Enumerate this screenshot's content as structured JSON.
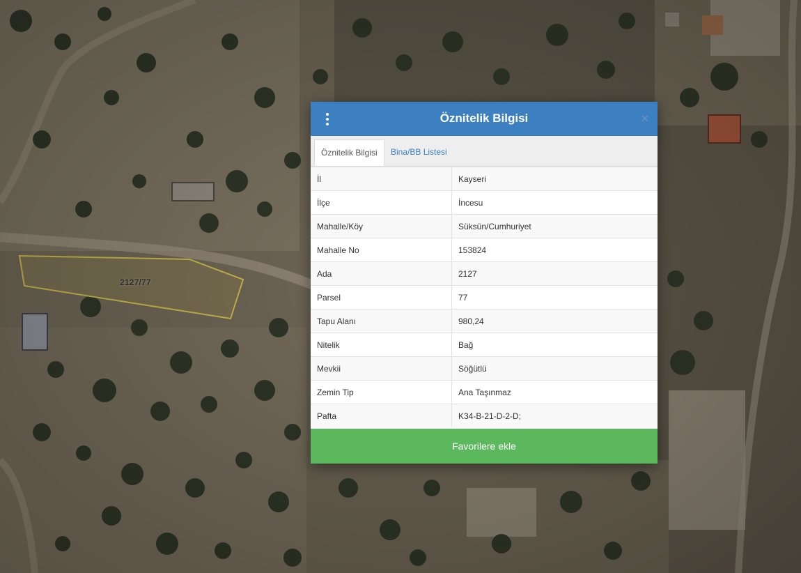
{
  "map": {
    "parcel_label": "2127/77",
    "parcel_outline_color": "#c9b94a"
  },
  "dialog": {
    "title": "Öznitelik Bilgisi",
    "menu_icon": "vertical-ellipsis-icon",
    "close_icon": "close-icon",
    "close_glyph": "×",
    "header_color": "#3d80c2",
    "tabs": [
      {
        "label": "Öznitelik Bilgisi",
        "active": true
      },
      {
        "label": "Bina/BB Listesi",
        "active": false
      }
    ],
    "rows": [
      {
        "key": "İl",
        "value": "Kayseri"
      },
      {
        "key": "İlçe",
        "value": "İncesu"
      },
      {
        "key": "Mahalle/Köy",
        "value": "Süksün/Cumhuriyet"
      },
      {
        "key": "Mahalle No",
        "value": "153824"
      },
      {
        "key": "Ada",
        "value": "2127"
      },
      {
        "key": "Parsel",
        "value": "77"
      },
      {
        "key": "Tapu Alanı",
        "value": "980,24"
      },
      {
        "key": "Nitelik",
        "value": "Bağ"
      },
      {
        "key": "Mevkii",
        "value": "Söğütlü"
      },
      {
        "key": "Zemin Tip",
        "value": "Ana Taşınmaz"
      },
      {
        "key": "Pafta",
        "value": "K34-B-21-D-2-D;"
      }
    ],
    "favorite_button": "Favorilere ekle",
    "favorite_color": "#5cb85c"
  }
}
